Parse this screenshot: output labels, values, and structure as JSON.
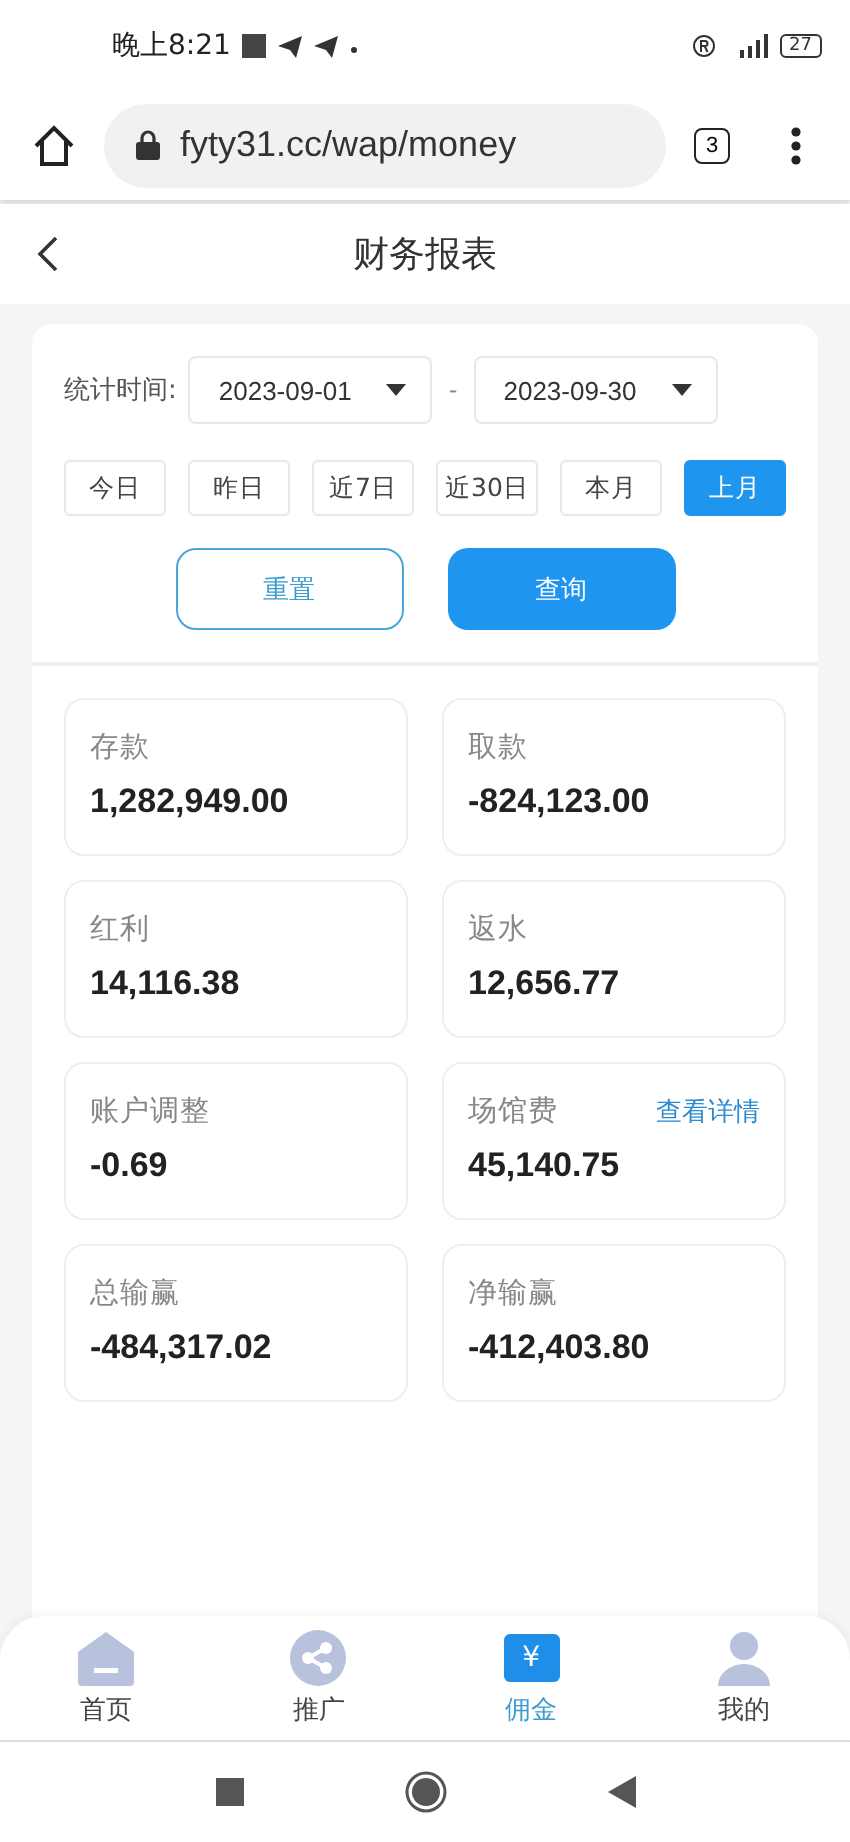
{
  "status_bar": {
    "time": "晚上8:21",
    "battery": "27"
  },
  "browser": {
    "url": "fyty31.cc/wap/money",
    "tab_count": "3"
  },
  "header": {
    "title": "财务报表"
  },
  "filter": {
    "label": "统计时间:",
    "start": "2023-09-01",
    "separator": "-",
    "end": "2023-09-30",
    "ranges": [
      {
        "label": "今日",
        "selected": false
      },
      {
        "label": "昨日",
        "selected": false
      },
      {
        "label": "近7日",
        "selected": false
      },
      {
        "label": "近30日",
        "selected": false
      },
      {
        "label": "本月",
        "selected": false
      },
      {
        "label": "上月",
        "selected": true
      }
    ],
    "reset": "重置",
    "query": "查询"
  },
  "stats": [
    {
      "label": "存款",
      "value": "1,282,949.00"
    },
    {
      "label": "取款",
      "value": "-824,123.00"
    },
    {
      "label": "红利",
      "value": "14,116.38"
    },
    {
      "label": "返水",
      "value": "12,656.77"
    },
    {
      "label": "账户调整",
      "value": "-0.69"
    },
    {
      "label": "场馆费",
      "value": "45,140.75",
      "link": "查看详情"
    },
    {
      "label": "总输赢",
      "value": "-484,317.02"
    },
    {
      "label": "净输赢",
      "value": "-412,403.80"
    }
  ],
  "tabbar": [
    {
      "kind": "home",
      "label": "首页",
      "selected": false
    },
    {
      "kind": "share",
      "label": "推广",
      "selected": false
    },
    {
      "kind": "coupon",
      "label": "佣金",
      "selected": true,
      "icon_glyph": "¥"
    },
    {
      "kind": "user",
      "label": "我的",
      "selected": false
    }
  ]
}
